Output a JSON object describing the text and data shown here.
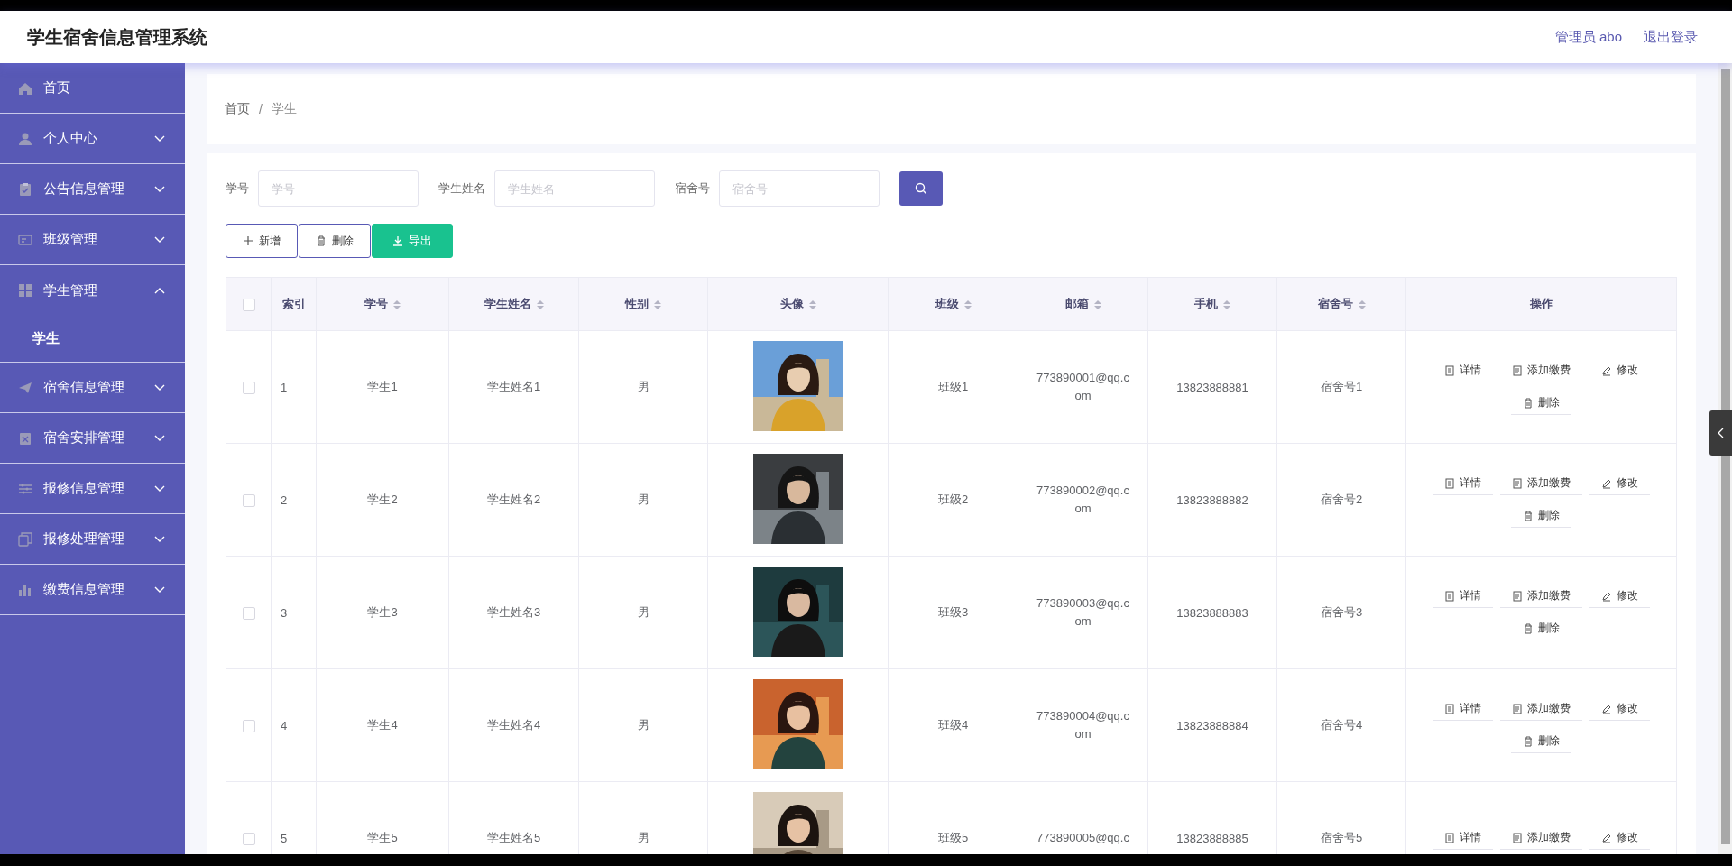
{
  "app": {
    "title": "学生宿舍信息管理系统",
    "user": "管理员 abo",
    "logout": "退出登录"
  },
  "sidebar": {
    "items": [
      {
        "label": "首页",
        "kind": "link"
      },
      {
        "label": "个人中心",
        "kind": "menu",
        "expanded": false
      },
      {
        "label": "公告信息管理",
        "kind": "menu",
        "expanded": false
      },
      {
        "label": "班级管理",
        "kind": "menu",
        "expanded": false
      },
      {
        "label": "学生管理",
        "kind": "menu",
        "expanded": true,
        "children": [
          {
            "label": "学生",
            "selected": true
          }
        ]
      },
      {
        "label": "宿舍信息管理",
        "kind": "menu",
        "expanded": false
      },
      {
        "label": "宿舍安排管理",
        "kind": "menu",
        "expanded": false
      },
      {
        "label": "报修信息管理",
        "kind": "menu",
        "expanded": false
      },
      {
        "label": "报修处理管理",
        "kind": "menu",
        "expanded": false
      },
      {
        "label": "缴费信息管理",
        "kind": "menu",
        "expanded": false
      }
    ]
  },
  "breadcrumb": {
    "items": [
      "首页",
      "学生"
    ],
    "separator": "/"
  },
  "search": {
    "fields": [
      {
        "label": "学号",
        "placeholder": "学号"
      },
      {
        "label": "学生姓名",
        "placeholder": "学生姓名"
      },
      {
        "label": "宿舍号",
        "placeholder": "宿舍号"
      }
    ]
  },
  "toolbar": [
    {
      "label": "新增",
      "kind": "add"
    },
    {
      "label": "删除",
      "kind": "delete"
    },
    {
      "label": "导出",
      "kind": "export"
    }
  ],
  "table": {
    "select_all": {
      "checked": false
    },
    "columns": [
      {
        "label": "索引",
        "sortable": false
      },
      {
        "label": "学号",
        "sortable": true
      },
      {
        "label": "学生姓名",
        "sortable": true
      },
      {
        "label": "性别",
        "sortable": true
      },
      {
        "label": "头像",
        "sortable": true
      },
      {
        "label": "班级",
        "sortable": true
      },
      {
        "label": "邮箱",
        "sortable": true
      },
      {
        "label": "手机",
        "sortable": true
      },
      {
        "label": "宿舍号",
        "sortable": true
      },
      {
        "label": "操作",
        "sortable": false
      }
    ],
    "rows": [
      {
        "checked": false,
        "index": "1",
        "student_no": "学生1",
        "name": "学生姓名1",
        "gender": "男",
        "class": "班级1",
        "email": "773890001@qq.com",
        "phone": "13823888881",
        "dorm": "宿舍号1",
        "actions": [
          {
            "label": "详情",
            "kind": "detail"
          },
          {
            "label": "添加缴费",
            "kind": "fee"
          },
          {
            "label": "修改",
            "kind": "edit"
          },
          {
            "label": "删除",
            "kind": "delete"
          }
        ]
      },
      {
        "checked": false,
        "index": "2",
        "student_no": "学生2",
        "name": "学生姓名2",
        "gender": "男",
        "class": "班级2",
        "email": "773890002@qq.com",
        "phone": "13823888882",
        "dorm": "宿舍号2",
        "actions": [
          {
            "label": "详情",
            "kind": "detail"
          },
          {
            "label": "添加缴费",
            "kind": "fee"
          },
          {
            "label": "修改",
            "kind": "edit"
          },
          {
            "label": "删除",
            "kind": "delete"
          }
        ]
      },
      {
        "checked": false,
        "index": "3",
        "student_no": "学生3",
        "name": "学生姓名3",
        "gender": "男",
        "class": "班级3",
        "email": "773890003@qq.com",
        "phone": "13823888883",
        "dorm": "宿舍号3",
        "actions": [
          {
            "label": "详情",
            "kind": "detail"
          },
          {
            "label": "添加缴费",
            "kind": "fee"
          },
          {
            "label": "修改",
            "kind": "edit"
          },
          {
            "label": "删除",
            "kind": "delete"
          }
        ]
      },
      {
        "checked": false,
        "index": "4",
        "student_no": "学生4",
        "name": "学生姓名4",
        "gender": "男",
        "class": "班级4",
        "email": "773890004@qq.com",
        "phone": "13823888884",
        "dorm": "宿舍号4",
        "actions": [
          {
            "label": "详情",
            "kind": "detail"
          },
          {
            "label": "添加缴费",
            "kind": "fee"
          },
          {
            "label": "修改",
            "kind": "edit"
          },
          {
            "label": "删除",
            "kind": "delete"
          }
        ]
      },
      {
        "checked": false,
        "index": "5",
        "student_no": "学生5",
        "name": "学生姓名5",
        "gender": "男",
        "class": "班级5",
        "email": "773890005@qq.c",
        "phone": "13823888885",
        "dorm": "宿舍号5",
        "actions": [
          {
            "label": "详情",
            "kind": "detail"
          },
          {
            "label": "添加缴费",
            "kind": "fee"
          },
          {
            "label": "修改",
            "kind": "edit"
          }
        ]
      }
    ]
  }
}
